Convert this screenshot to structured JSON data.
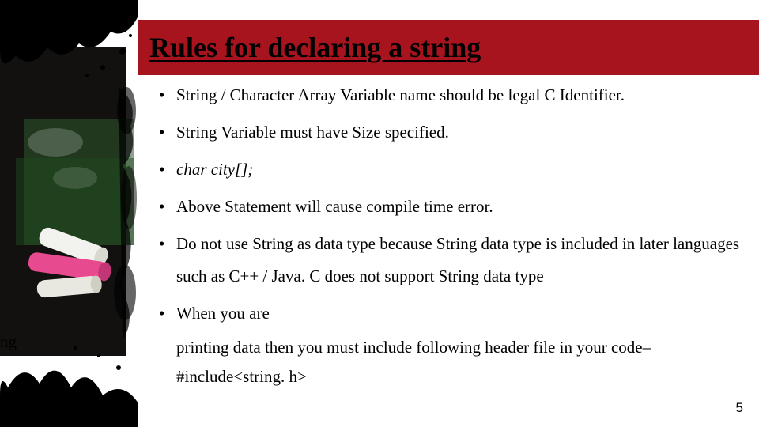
{
  "title": "Rules for declaring a string",
  "bullets": {
    "b1": "String / Character Array Variable name should be legal C Identifier.",
    "b2": "String Variable must have Size specified.",
    "b3": "char city[];",
    "b4": "Above Statement will cause compile time error.",
    "b5": "Do not use String as data type because String data type is included in later languages such as C++ / Java. C does not support String data type",
    "b6": "When you  are",
    "b6_cont1": "printing data then you must include following header file in your code–",
    "b6_cont2": "#include<string. h>"
  },
  "left_fragment": "ng",
  "page_number": "5"
}
